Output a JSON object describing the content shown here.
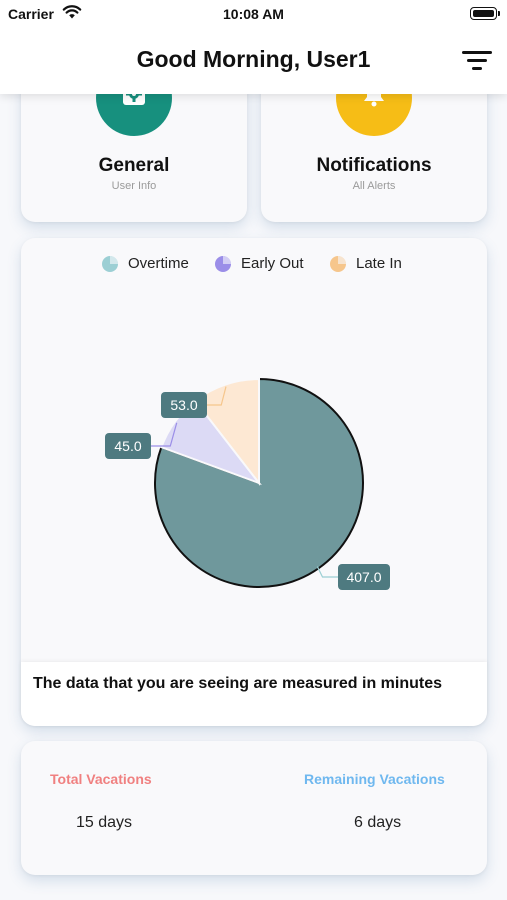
{
  "status_bar": {
    "carrier": "Carrier",
    "time": "10:08 AM"
  },
  "header": {
    "title": "Good Morning, User1",
    "menu_icon": "filter-lines-icon"
  },
  "tiles": [
    {
      "title": "General",
      "subtitle": "User Info",
      "icon": "settings-gear-icon",
      "color": "#17907e"
    },
    {
      "title": "Notifications",
      "subtitle": "All Alerts",
      "icon": "bell-icon",
      "color": "#f6bd16"
    }
  ],
  "chart": {
    "note": "The data that you are seeing are measured in minutes"
  },
  "chart_data": {
    "type": "pie",
    "categories": [
      "Overtime",
      "Early Out",
      "Late In"
    ],
    "values": [
      407.0,
      45.0,
      53.0
    ],
    "labels": [
      "407.0",
      "45.0",
      "53.0"
    ],
    "colors": [
      "#6f989c",
      "#dcdaf5",
      "#fde8d3"
    ],
    "legend_colors": [
      "#9ccfd4",
      "#9b8ee8",
      "#f6c68c"
    ],
    "label_bg": "#4e7a80",
    "exploded": "Overtime",
    "legend_position": "top"
  },
  "vacations": {
    "total_label": "Total Vacations",
    "total_value": "15 days",
    "remaining_label": "Remaining Vacations",
    "remaining_value": "6 days",
    "total_color": "#f08080",
    "remaining_color": "#6fb8ef"
  }
}
